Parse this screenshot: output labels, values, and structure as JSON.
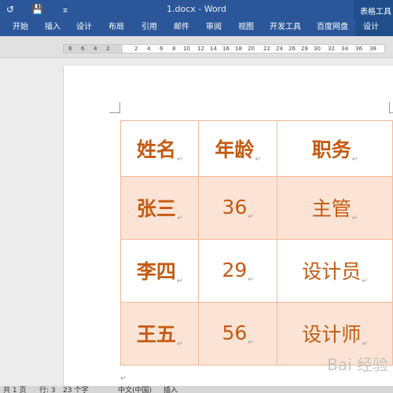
{
  "window": {
    "doc_title": "1.docx - Word",
    "context_tab": "表格工具",
    "quick_access": [
      "↺",
      "💾",
      "⌅"
    ]
  },
  "ribbon": {
    "tabs": [
      "开始",
      "插入",
      "设计",
      "布局",
      "引用",
      "邮件",
      "审阅",
      "视图",
      "开发工具",
      "百度网盘",
      "设计"
    ]
  },
  "ruler": {
    "numbers": [
      "8",
      "6",
      "4",
      "2",
      "2",
      "4",
      "6",
      "8",
      "10",
      "12",
      "14",
      "16",
      "18",
      "20",
      "22",
      "24",
      "26",
      "28",
      "30",
      "32",
      "34",
      "36",
      "38"
    ]
  },
  "table": {
    "header": [
      "姓名",
      "年龄",
      "职务"
    ],
    "rows": [
      [
        "张三",
        "36",
        "主管"
      ],
      [
        "李四",
        "29",
        "设计员"
      ],
      [
        "王五",
        "56",
        "设计师"
      ]
    ],
    "paragraph_mark": "↵"
  },
  "status": {
    "page": "共 1 页",
    "line": "行: 3",
    "words": "23 个字",
    "language": "中文(中国)",
    "mode": "插入"
  },
  "watermark": "Bai 经验"
}
